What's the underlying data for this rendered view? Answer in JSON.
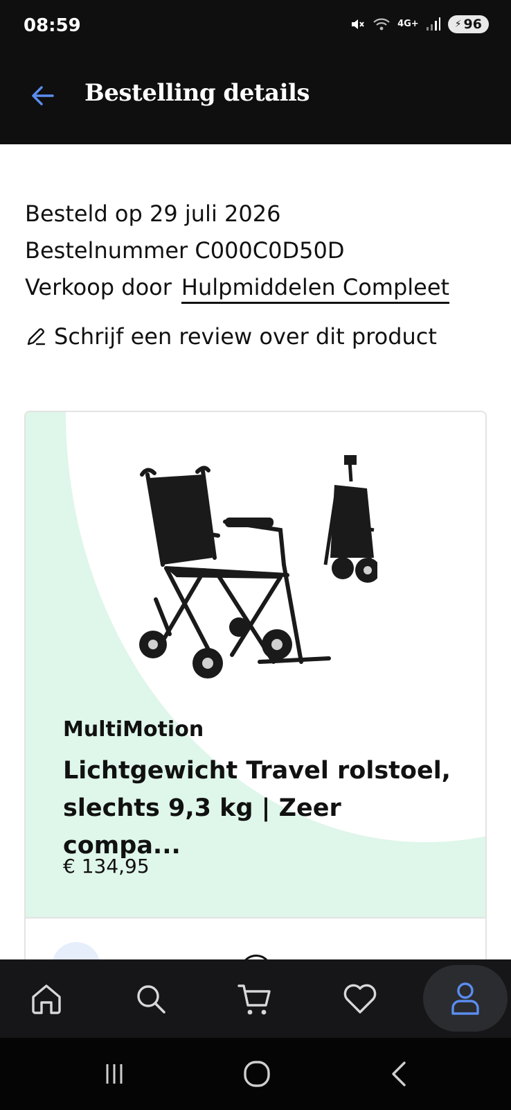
{
  "status_bar": {
    "time": "08:59",
    "network": "4G+",
    "battery": "96"
  },
  "header": {
    "title": "Bestelling details",
    "back_icon": "arrow-left-icon"
  },
  "order": {
    "ordered_on": "Besteld op 29 juli 2026",
    "order_number": "Bestelnummer C000C0D50D",
    "sold_by_label": "Verkoop door",
    "seller": "Hulpmiddelen Compleet",
    "review_link": "Schrijf een review over dit product"
  },
  "product": {
    "brand": "MultiMotion",
    "title": "Lichtgewicht Travel rolstoel, slechts 9,3 kg | Zeer compa...",
    "price": "€ 134,95",
    "image": "wheelchair-image"
  },
  "bottom_nav": {
    "items": [
      {
        "name": "home",
        "icon": "home-icon"
      },
      {
        "name": "search",
        "icon": "search-icon"
      },
      {
        "name": "cart",
        "icon": "cart-icon"
      },
      {
        "name": "wishlist",
        "icon": "heart-icon"
      },
      {
        "name": "account",
        "icon": "user-icon",
        "active": true
      }
    ]
  },
  "colors": {
    "header_bg": "#0f0f10",
    "accent_blue": "#5b8def",
    "hero_mint": "#dff6ea",
    "nav_bg": "#161618"
  }
}
